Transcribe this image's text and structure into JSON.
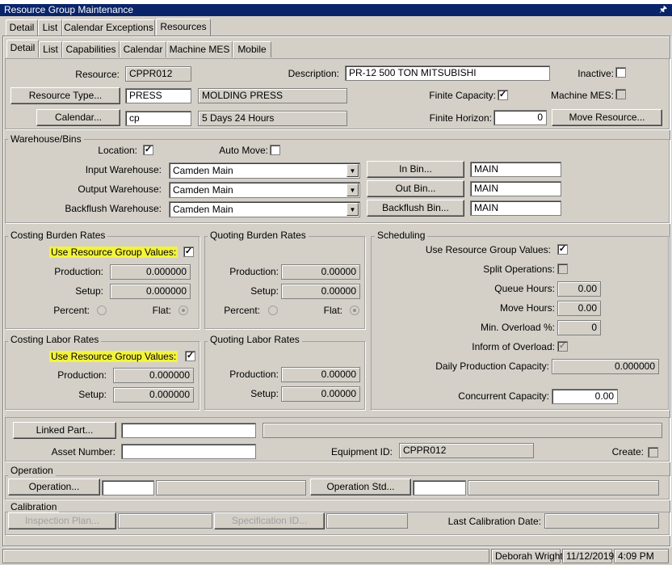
{
  "window": {
    "title": "Resource Group Maintenance",
    "pin_icon": "pin-icon"
  },
  "tabs_top": [
    {
      "label": "Detail"
    },
    {
      "label": "List"
    },
    {
      "label": "Calendar Exceptions"
    },
    {
      "label": "Resources"
    }
  ],
  "tabs_sub": [
    {
      "label": "Detail"
    },
    {
      "label": "List"
    },
    {
      "label": "Capabilities"
    },
    {
      "label": "Calendar"
    },
    {
      "label": "Machine MES"
    },
    {
      "label": "Mobile"
    }
  ],
  "header": {
    "resource_label": "Resource:",
    "resource_value": "CPPR012",
    "description_label": "Description:",
    "description_value": "PR-12 500 TON MITSUBISHI",
    "inactive_label": "Inactive:",
    "inactive_checked": "",
    "resource_type_button": "Resource Type...",
    "resource_type_code": "PRESS",
    "resource_type_desc": "MOLDING PRESS",
    "finite_capacity_label": "Finite Capacity:",
    "finite_capacity_checked": "✓",
    "machine_mes_label": "Machine MES:",
    "machine_mes_checked": "",
    "calendar_button": "Calendar...",
    "calendar_code": "cp",
    "calendar_desc": "5 Days 24 Hours",
    "finite_horizon_label": "Finite Horizon:",
    "finite_horizon_value": "0",
    "move_resource_button": "Move Resource..."
  },
  "warehouse": {
    "title": "Warehouse/Bins",
    "location_label": "Location:",
    "location_checked": "✓",
    "auto_move_label": "Auto Move:",
    "auto_move_checked": "",
    "input_label": "Input Warehouse:",
    "input_value": "Camden Main",
    "in_bin_button": "In Bin...",
    "in_bin_value": "MAIN",
    "output_label": "Output Warehouse:",
    "output_value": "Camden Main",
    "out_bin_button": "Out Bin...",
    "out_bin_value": "MAIN",
    "backflush_label": "Backflush Warehouse:",
    "backflush_value": "Camden Main",
    "backflush_bin_button": "Backflush Bin...",
    "backflush_bin_value": "MAIN"
  },
  "costing_burden": {
    "title": "Costing Burden Rates",
    "use_group_label": "Use Resource Group Values:",
    "use_group_checked": "✓",
    "production_label": "Production:",
    "production_value": "0.000000",
    "setup_label": "Setup:",
    "setup_value": "0.000000",
    "percent_label": "Percent:",
    "flat_label": "Flat:"
  },
  "quoting_burden": {
    "title": "Quoting Burden Rates",
    "production_label": "Production:",
    "production_value": "0.00000",
    "setup_label": "Setup:",
    "setup_value": "0.00000",
    "percent_label": "Percent:",
    "flat_label": "Flat:"
  },
  "costing_labor": {
    "title": "Costing Labor Rates",
    "use_group_label": "Use Resource Group Values:",
    "use_group_checked": "✓",
    "production_label": "Production:",
    "production_value": "0.000000",
    "setup_label": "Setup:",
    "setup_value": "0.000000"
  },
  "quoting_labor": {
    "title": "Quoting Labor Rates",
    "production_label": "Production:",
    "production_value": "0.00000",
    "setup_label": "Setup:",
    "setup_value": "0.00000"
  },
  "scheduling": {
    "title": "Scheduling",
    "use_group_label": "Use Resource Group Values:",
    "use_group_checked": "✓",
    "split_label": "Split Operations:",
    "split_checked": "",
    "queue_label": "Queue Hours:",
    "queue_value": "0.00",
    "move_label": "Move Hours:",
    "move_value": "0.00",
    "overload_label": "Min. Overload %:",
    "overload_value": "0",
    "inform_label": "Inform of Overload:",
    "inform_checked": "✓",
    "daily_label": "Daily Production Capacity:",
    "daily_value": "0.000000",
    "concurrent_label": "Concurrent Capacity:",
    "concurrent_value": "0.00"
  },
  "linked": {
    "linked_part_button": "Linked Part...",
    "linked_part_value": "",
    "linked_part_desc": "",
    "asset_label": "Asset Number:",
    "asset_value": "",
    "equipment_label": "Equipment ID:",
    "equipment_value": "CPPR012",
    "create_label": "Create:",
    "create_checked": ""
  },
  "operation": {
    "title": "Operation",
    "operation_button": "Operation...",
    "operation_value": "",
    "operation_desc": "",
    "operation_std_button": "Operation Std...",
    "operation_std_value": "",
    "operation_std_desc": ""
  },
  "calibration": {
    "title": "Calibration",
    "inspection_button": "Inspection Plan...",
    "inspection_value": "",
    "specification_button": "Specification ID...",
    "specification_value": "",
    "last_date_label": "Last Calibration Date:",
    "last_date_value": ""
  },
  "status": {
    "user": "Deborah Wright",
    "date": "11/12/2019",
    "time": "4:09 PM"
  }
}
